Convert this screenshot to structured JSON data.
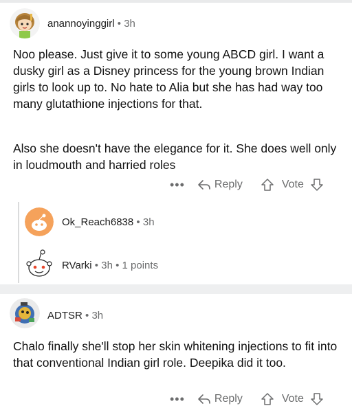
{
  "comment1": {
    "username": "anannoyinggirl",
    "separator": "•",
    "time": "3h",
    "paragraphs": [
      "Noo please. Just give it to some young ABCD girl. I want a dusky girl as a Disney princess for the young brown Indian girls to look up to. No hate to Alia but she has had way too many glutathione injections for that.",
      "Also she doesn't have the elegance for it. She does well only in loudmouth and harried roles"
    ],
    "more": "•••",
    "reply_label": "Reply",
    "vote_label": "Vote"
  },
  "reply1": {
    "username": "Ok_Reach6838",
    "separator": "•",
    "time": "3h"
  },
  "reply2": {
    "username": "RVarki",
    "separator": "•",
    "time": "3h",
    "points": "1 points"
  },
  "comment2": {
    "username": "ADTSR",
    "separator": "•",
    "time": "3h",
    "paragraphs": [
      "Chalo finally she'll stop her skin whitening injections to fit into that conventional Indian girl role. Deepika did it too."
    ],
    "more": "•••",
    "reply_label": "Reply",
    "vote_label": "Vote"
  },
  "icons": {
    "avatar1": "cartoon-girl-avatar",
    "avatar2": "orange-snoo-avatar",
    "avatar3": "snoo-avatar",
    "avatar4": "robot-avatar",
    "reply": "reply-arrow-icon",
    "upvote": "upvote-arrow-icon",
    "downvote": "downvote-arrow-icon"
  },
  "colors": {
    "meta": "#6b6c6d",
    "text": "#111111",
    "separator": "#eeeff0"
  }
}
